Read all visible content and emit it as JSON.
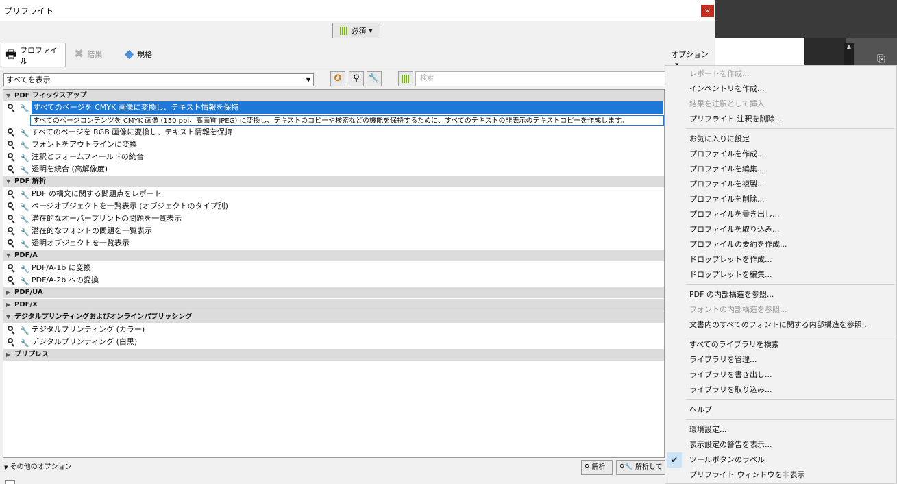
{
  "window": {
    "title": "プリフライト",
    "close_label": "×"
  },
  "toolbar": {
    "required_label": "必須"
  },
  "tabs": [
    {
      "label": "プロファイル"
    },
    {
      "label": "結果"
    },
    {
      "label": "規格"
    }
  ],
  "options_label": "オプション",
  "filter": {
    "selected": "すべてを表示"
  },
  "search": {
    "placeholder": "検索"
  },
  "categories": [
    {
      "label": "PDF フィックスアップ",
      "expanded": true
    },
    {
      "label": "PDF 解析",
      "expanded": true
    },
    {
      "label": "PDF/A",
      "expanded": true
    },
    {
      "label": "PDF/UA",
      "expanded": false
    },
    {
      "label": "PDF/X",
      "expanded": false
    },
    {
      "label": "デジタルプリンティングおよびオンラインパブリッシング",
      "expanded": true
    },
    {
      "label": "プリプレス",
      "expanded": false
    }
  ],
  "items": [
    "すべてのページを CMYK 画像に変換し、テキスト情報を保持",
    "すべてのページを RGB 画像に変換し、テキスト情報を保持",
    "フォントをアウトラインに変換",
    "注釈とフォームフィールドの統合",
    "透明を統合 (高解像度)",
    "PDF の構文に関する問題点をレポート",
    "ページオブジェクトを一覧表示 (オブジェクトのタイプ別)",
    "潜在的なオーバープリントの問題を一覧表示",
    "潜在的なフォントの問題を一覧表示",
    "透明オブジェクトを一覧表示",
    "PDF/A-1b に変換",
    "PDF/A-2b への変換",
    "デジタルプリンティング (カラー)",
    "デジタルプリンティング (白黒)"
  ],
  "selected_description": "すべてのページコンテンツを CMYK 画像 (150 ppi、高画質 JPEG) に変換し、テキストのコピーや検索などの機能を保持するために、すべてのテキストの非表示のテキストコピーを作成します。",
  "footer": {
    "more_options": "その他のオプション",
    "analyze": "解析",
    "analyze_fix": "解析して"
  },
  "menu": [
    {
      "label": "レポートを作成...",
      "disabled": true
    },
    {
      "label": "インベントリを作成...",
      "disabled": false
    },
    {
      "label": "結果を注釈として挿入",
      "disabled": true
    },
    {
      "label": "プリフライト 注釈を削除...",
      "disabled": false
    },
    {
      "label": "お気に入りに設定",
      "disabled": false
    },
    {
      "label": "プロファイルを作成...",
      "disabled": false
    },
    {
      "label": "プロファイルを編集...",
      "disabled": false
    },
    {
      "label": "プロファイルを複製...",
      "disabled": false
    },
    {
      "label": "プロファイルを削除...",
      "disabled": false
    },
    {
      "label": "プロファイルを書き出し...",
      "disabled": false
    },
    {
      "label": "プロファイルを取り込み...",
      "disabled": false
    },
    {
      "label": "プロファイルの要約を作成...",
      "disabled": false
    },
    {
      "label": "ドロップレットを作成...",
      "disabled": false
    },
    {
      "label": "ドロップレットを編集...",
      "disabled": false
    },
    {
      "label": "PDF の内部構造を参照...",
      "disabled": false
    },
    {
      "label": "フォントの内部構造を参照...",
      "disabled": true
    },
    {
      "label": "文書内のすべてのフォントに関する内部構造を参照...",
      "disabled": false
    },
    {
      "label": "すべてのライブラリを検索",
      "disabled": false
    },
    {
      "label": "ライブラリを管理...",
      "disabled": false
    },
    {
      "label": "ライブラリを書き出し...",
      "disabled": false
    },
    {
      "label": "ライブラリを取り込み...",
      "disabled": false
    },
    {
      "label": "ヘルプ",
      "disabled": false
    },
    {
      "label": "環境設定...",
      "disabled": false
    },
    {
      "label": "表示設定の警告を表示...",
      "disabled": false
    },
    {
      "label": "ツールボタンのラベル",
      "disabled": false,
      "checked": true
    },
    {
      "label": "プリフライト ウィンドウを非表示",
      "disabled": false
    }
  ],
  "colors": {
    "selection": "#1e78d7",
    "accent_green": "#7cb518",
    "close": "#c42b1c"
  }
}
